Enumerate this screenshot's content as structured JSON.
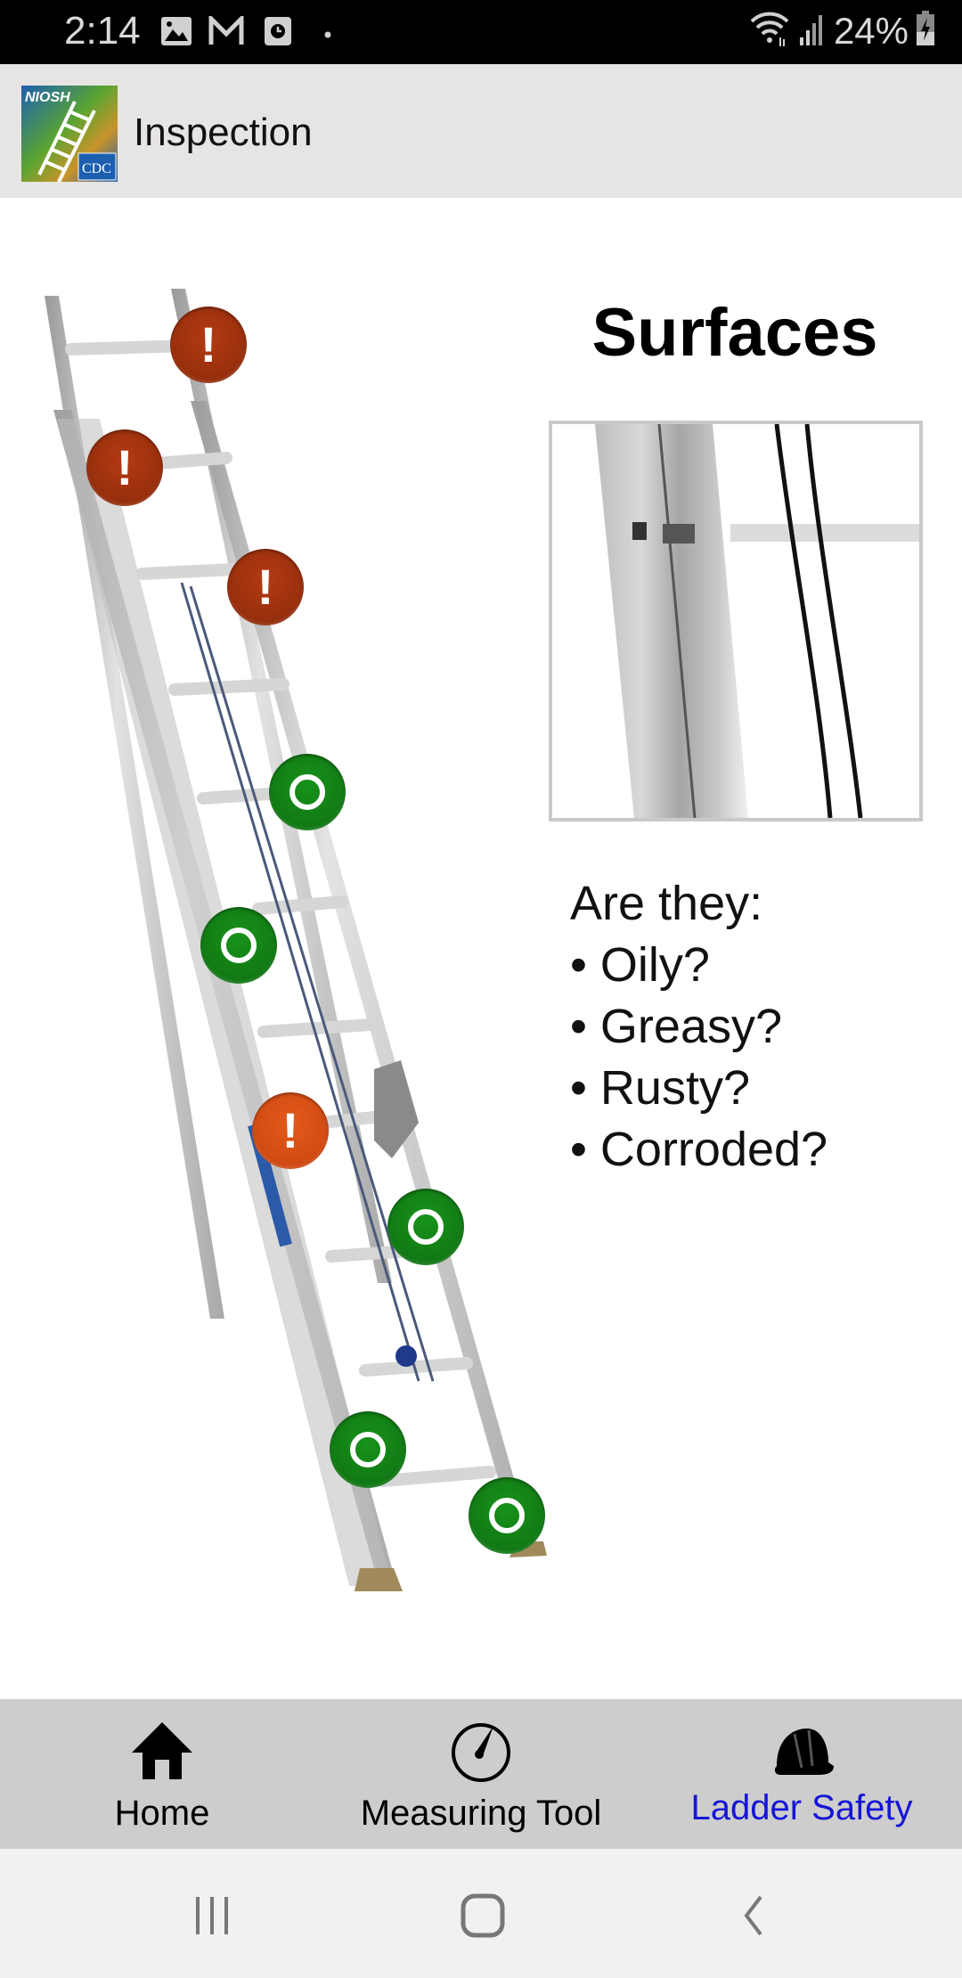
{
  "status_bar": {
    "time": "2:14",
    "notification_icons": [
      "image-icon",
      "gmail-icon",
      "clock-app-icon",
      "dot-icon"
    ],
    "system_icons": [
      "wifi-icon",
      "signal-icon",
      "battery-charging-icon"
    ],
    "battery_percent": "24%"
  },
  "app_bar": {
    "logo_label": "NIOSH CDC ladder logo",
    "title": "Inspection"
  },
  "ladder": {
    "markers": [
      {
        "type": "warning",
        "icon": "exclamation-icon"
      },
      {
        "type": "warning",
        "icon": "exclamation-icon"
      },
      {
        "type": "warning",
        "icon": "exclamation-icon"
      },
      {
        "type": "ok",
        "icon": "ring-icon"
      },
      {
        "type": "ok",
        "icon": "ring-icon"
      },
      {
        "type": "warning-active",
        "icon": "exclamation-icon"
      },
      {
        "type": "ok",
        "icon": "ring-icon"
      },
      {
        "type": "ok",
        "icon": "ring-icon"
      },
      {
        "type": "ok",
        "icon": "ring-icon"
      }
    ],
    "colors": {
      "warning": "#9a300d",
      "warning_active": "#d54b15",
      "ok": "#138017"
    }
  },
  "detail": {
    "title": "Surfaces",
    "image_label": "Close-up of ladder rail and rung",
    "prompt": "Are they:",
    "items": [
      "Oily?",
      "Greasy?",
      "Rusty?",
      "Corroded?"
    ]
  },
  "bottom_nav": {
    "tabs": [
      {
        "label": "Home",
        "icon": "home-icon",
        "active": false
      },
      {
        "label": "Measuring Tool",
        "icon": "gauge-icon",
        "active": false
      },
      {
        "label": "Ladder Safety",
        "icon": "hard-hat-icon",
        "active": true
      }
    ],
    "active_color": "#1515d6"
  },
  "system_nav": {
    "buttons": [
      "recent-apps-icon",
      "home-circle-icon",
      "back-icon"
    ]
  }
}
